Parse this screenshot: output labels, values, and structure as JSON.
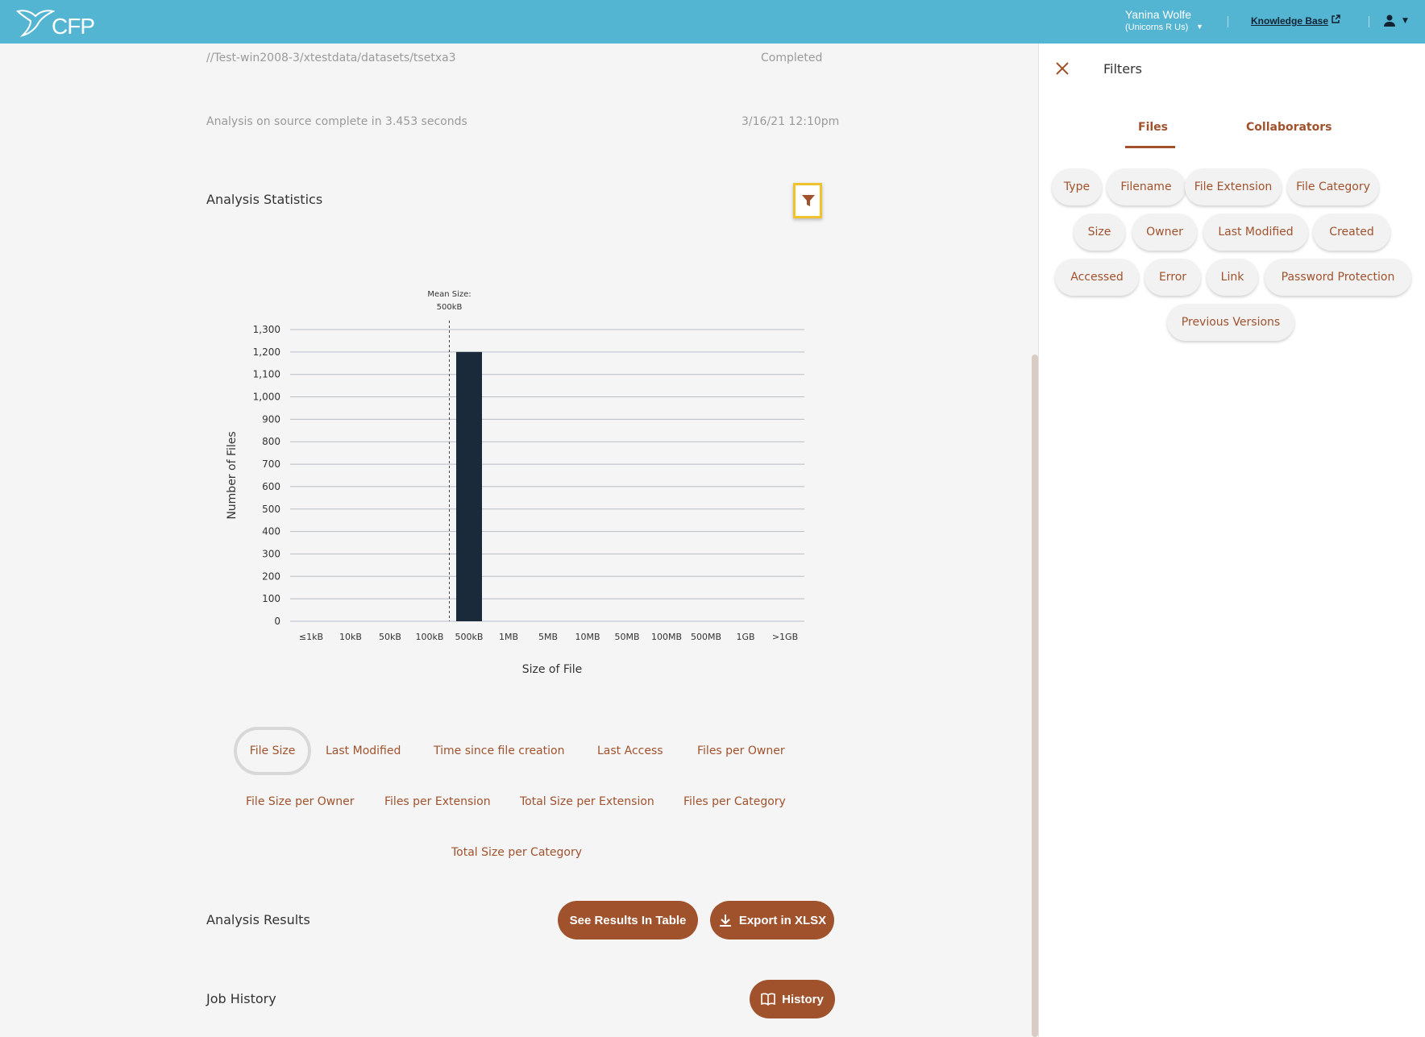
{
  "header": {
    "logo_text": "CFP",
    "user_name": "Yanina Wolfe",
    "user_org": "(Unicorns R Us)",
    "knowledge_base": "Knowledge Base"
  },
  "job": {
    "path": "//Test-win2008-3/xtestdata/datasets/tsetxa3",
    "status": "Completed",
    "analysis_text": "Analysis on source complete in 3.453 seconds",
    "analysis_date": "3/16/21 12:10pm"
  },
  "sections": {
    "analysis_statistics": "Analysis Statistics",
    "analysis_results": "Analysis Results",
    "job_history": "Job History"
  },
  "chart_data": {
    "type": "bar",
    "categories": [
      "≤1kB",
      "10kB",
      "50kB",
      "100kB",
      "500kB",
      "1MB",
      "5MB",
      "10MB",
      "50MB",
      "100MB",
      "500MB",
      "1GB",
      ">1GB"
    ],
    "values": [
      0,
      0,
      0,
      0,
      1200,
      0,
      0,
      0,
      0,
      0,
      0,
      0,
      0
    ],
    "xlabel": "Size of File",
    "ylabel": "Number of Files",
    "ylim": [
      0,
      1300
    ],
    "yticks": [
      0,
      100,
      200,
      300,
      400,
      500,
      600,
      700,
      800,
      900,
      1000,
      1100,
      1200,
      1300
    ],
    "mean_line": {
      "label_line1": "Mean Size:",
      "label_line2": "500kB"
    },
    "grid": true,
    "bar_color": "#1b2a3a"
  },
  "stat_tabs": [
    "File Size",
    "Last Modified",
    "Time since file creation",
    "Last Access",
    "Files per Owner",
    "File Size per Owner",
    "Files per Extension",
    "Total Size per Extension",
    "Files per Category",
    "Total Size per Category"
  ],
  "buttons": {
    "see_results": "See Results In Table",
    "export": "Export in XLSX",
    "history": "History"
  },
  "filters_panel": {
    "title": "Filters",
    "tabs": [
      "Files",
      "Collaborators"
    ],
    "chips": [
      "Type",
      "Filename",
      "File Extension",
      "File Category",
      "Size",
      "Owner",
      "Last Modified",
      "Created",
      "Accessed",
      "Error",
      "Link",
      "Password Protection",
      "Previous Versions"
    ]
  },
  "colors": {
    "topbar": "#53b5d2",
    "accent": "#a0522d",
    "highlight": "#f0c22d"
  }
}
